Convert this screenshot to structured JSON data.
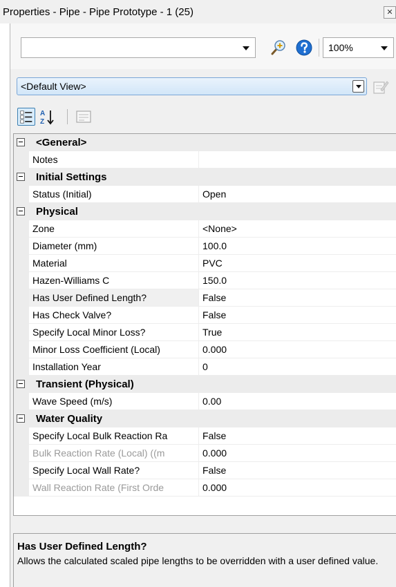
{
  "window": {
    "title": "Properties - Pipe - Pipe Prototype - 1 (25)",
    "close_glyph": "✕"
  },
  "toolbar": {
    "find_value": "",
    "zoom_value": "100%"
  },
  "view": {
    "selected": "<Default View>"
  },
  "grid": {
    "rows": [
      {
        "kind": "category",
        "label": "<General>"
      },
      {
        "kind": "property",
        "name": "Notes",
        "value": ""
      },
      {
        "kind": "category",
        "label": "Initial Settings"
      },
      {
        "kind": "property",
        "name": "Status (Initial)",
        "value": "Open"
      },
      {
        "kind": "category",
        "label": "Physical"
      },
      {
        "kind": "property",
        "name": "Zone",
        "value": "<None>"
      },
      {
        "kind": "property",
        "name": "Diameter (mm)",
        "value": "100.0"
      },
      {
        "kind": "property",
        "name": "Material",
        "value": "PVC"
      },
      {
        "kind": "property",
        "name": "Hazen-Williams C",
        "value": "150.0"
      },
      {
        "kind": "property",
        "name": "Has User Defined Length?",
        "value": "False",
        "selected": true
      },
      {
        "kind": "property",
        "name": "Has Check Valve?",
        "value": "False"
      },
      {
        "kind": "property",
        "name": "Specify Local Minor Loss?",
        "value": "True"
      },
      {
        "kind": "property",
        "name": "Minor Loss Coefficient (Local)",
        "value": "0.000"
      },
      {
        "kind": "property",
        "name": "Installation Year",
        "value": "0"
      },
      {
        "kind": "category",
        "label": "Transient (Physical)"
      },
      {
        "kind": "property",
        "name": "Wave Speed (m/s)",
        "value": "0.00"
      },
      {
        "kind": "category",
        "label": "Water Quality"
      },
      {
        "kind": "property",
        "name": "Specify Local Bulk Reaction Ra",
        "value": "False"
      },
      {
        "kind": "property",
        "name": "Bulk Reaction Rate (Local) ((m",
        "value": "0.000",
        "readonly": true
      },
      {
        "kind": "property",
        "name": "Specify Local Wall Rate?",
        "value": "False"
      },
      {
        "kind": "property",
        "name": "Wall Reaction Rate (First Orde",
        "value": "0.000",
        "readonly": true
      }
    ]
  },
  "help": {
    "title": "Has User Defined Length?",
    "description": "Allows the calculated scaled pipe lengths to be overridden with a user defined value."
  },
  "icons": {
    "find": "find-zoom-icon",
    "help": "help-icon",
    "edit_view": "edit-view-icon",
    "categorized": "categorized-icon",
    "alphabetical": "alphabetical-sort-icon",
    "property_pages": "property-pages-icon"
  },
  "colors": {
    "help_blue": "#1f6fd1",
    "view_combo": "#d2e6f8"
  }
}
